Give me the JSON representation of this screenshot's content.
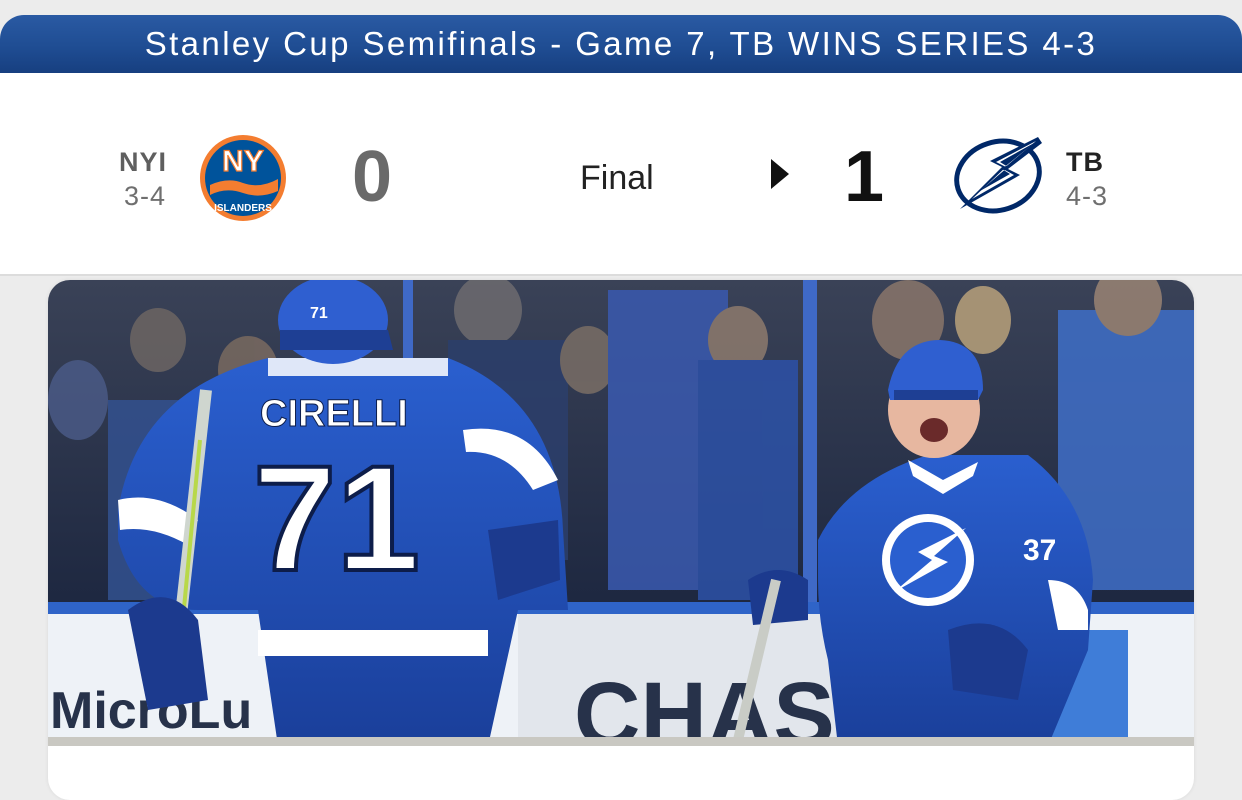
{
  "banner": {
    "title": "Stanley Cup Semifinals - Game 7, TB WINS SERIES 4-3"
  },
  "game": {
    "status": "Final",
    "away": {
      "abbr": "NYI",
      "record": "3-4",
      "score": "0",
      "logo_icon": "islanders-logo-icon",
      "logo_text": "NY",
      "logo_subtext": "ISLANDERS",
      "color": "#00539b",
      "accent": "#f47d30"
    },
    "home": {
      "abbr": "TB",
      "record": "4-3",
      "score": "1",
      "logo_icon": "lightning-bolt-logo-icon",
      "color": "#002868",
      "winner": true
    }
  },
  "photo": {
    "jersey_name": "CIRELLI",
    "jersey_number": "71",
    "helmet_number": "71",
    "second_number": "37",
    "board_text_1": "MicroLu",
    "board_text_2": "CHAS",
    "colors": {
      "jersey": "#1f4fb8",
      "crowd": "#26334f",
      "ice": "#eef2f7"
    }
  }
}
